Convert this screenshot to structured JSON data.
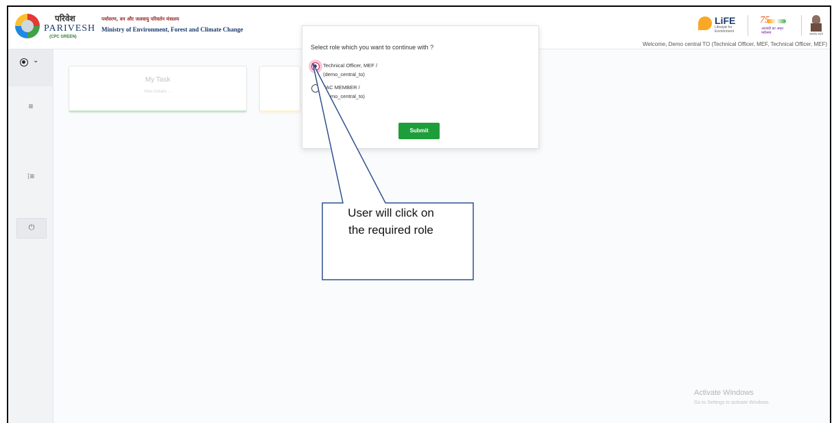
{
  "header": {
    "brand_hindi": "परिवेश",
    "brand_name": "PARIVESH",
    "brand_sub": "(CPC GREEN)",
    "ministry_hindi": "पर्यावरण, वन और जलवायु परिवर्तन मंत्रालय",
    "ministry_en": "Ministry of Environment, Forest and Climate Change",
    "life_text": "LiFE",
    "life_sub": "Lifestyle for Environment",
    "azadi_number": "75",
    "azadi_text": "आज़ादी का अमृत महोत्सव",
    "emblem_caption": "सत्यमेव जयते",
    "welcome": "Welcome, Demo central TO (Technical Officer, MEF, Technical Officer, MEF)"
  },
  "sidebar": {
    "menu_icon": "≡",
    "list_icon": "⁝≡",
    "chevron": "⌄",
    "power_icon": "⏻"
  },
  "cards": {
    "my_task_title": "My Task",
    "my_task_link": "View Details →"
  },
  "modal": {
    "title": "Select role which you want to continue with ?",
    "options": [
      {
        "line1": "Technical Officer, MEF /",
        "line2": "(demo_central_to)",
        "selected": true
      },
      {
        "line1": "FAC MEMBER /",
        "line2": "(demo_central_to)",
        "selected": false
      }
    ],
    "submit_label": "Submit"
  },
  "callout": {
    "text": "User will click on\nthe required role"
  },
  "watermark": {
    "title": "Activate Windows",
    "subtitle": "Go to Settings to activate Windows."
  },
  "colors": {
    "submit_green": "#1e9e3a",
    "selected_highlight": "#e91e63",
    "callout_border": "#2f4f8f"
  }
}
